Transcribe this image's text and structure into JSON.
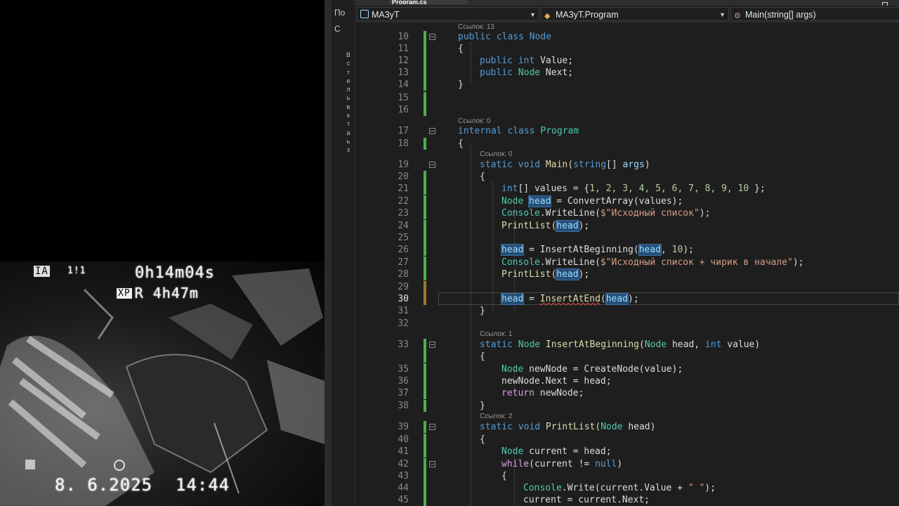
{
  "camera": {
    "badge_ia": "IA",
    "mode": "1!1",
    "timer": "0h14m04s",
    "rec_badge": "XP",
    "remaining": "R  4h47m",
    "date": "8. 6.2025",
    "time": "14:44"
  },
  "ide": {
    "tool_tab_1": "По",
    "tool_tab_2": "С",
    "vertical_letters": [
      "В",
      "с",
      "т",
      "е",
      "л",
      "ь",
      "в",
      "к",
      "т",
      "а",
      "ь",
      "з"
    ],
    "document_tab": "Program.cs",
    "nav": {
      "project": "MA3yT",
      "class": "MA3yT.Program",
      "member": "Main(string[] args)"
    },
    "refs": {
      "node_class": "Ссылок: 13",
      "program_class": "Ссылок: 0",
      "main": "Ссылок: 0",
      "insert_beginning": "Ссылок: 1",
      "print_list": "Ссылок: 2"
    },
    "line_numbers": [
      "10",
      "11",
      "12",
      "13",
      "14",
      "15",
      "16",
      "17",
      "18",
      "19",
      "20",
      "21",
      "22",
      "23",
      "24",
      "25",
      "26",
      "27",
      "28",
      "29",
      "30",
      "31",
      "32",
      "33",
      "35",
      "36",
      "37",
      "38",
      "39",
      "40",
      "41",
      "42",
      "43",
      "44",
      "45"
    ],
    "active_line": "30",
    "code": {
      "l10": "public class Node",
      "l11": "{",
      "l12a": "public int",
      "l12b": " Value;",
      "l13a": "public",
      "l13b": " Node",
      "l13c": " Next;",
      "l14": "}",
      "l17a": "internal class",
      "l17b": " Program",
      "l18": "{",
      "l19a": "static void",
      "l19b": " Main(",
      "l19c": "string",
      "l19d": "[] ",
      "l19e": "args",
      "l19f": ")",
      "l20": "{",
      "l21a": "int",
      "l21b": "[] values = {",
      "l21c": "1, 2, 3, 4, 5, 6, 7, 8, 9, 10",
      "l21d": " };",
      "l22a": "Node",
      "l22b": "head",
      "l22c": " = ConvertArray(values);",
      "l23a": "Console",
      "l23b": ".WriteLine(",
      "l23c": "$\"Исходный список\"",
      "l23d": ");",
      "l24a": "PrintList(",
      "l24b": "head",
      "l24c": ");",
      "l26a": "head",
      "l26b": " = InsertAtBeginning(",
      "l26c": "head",
      "l26d": ", ",
      "l26e": "10",
      "l26f": ");",
      "l27a": "Console",
      "l27b": ".WriteLine(",
      "l27c": "$\"Исходный список + чирик в начале\"",
      "l27d": ");",
      "l28a": "PrintList(",
      "l28b": "head",
      "l28c": ");",
      "l30a": "head",
      "l30b": " = ",
      "l30c": "InsertAtEnd",
      "l30d": "(",
      "l30e": "head",
      "l30f": ");",
      "l31": "}",
      "l33a": "static",
      "l33b": " Node",
      "l33c": " InsertAtBeginning(",
      "l33d": "Node",
      "l33e": " head, ",
      "l33f": "int",
      "l33g": " value)",
      "l35a": "Node",
      "l35b": " newNode = CreateNode(value);",
      "l36": "newNode.Next = head;",
      "l37a": "return",
      "l37b": " newNode;",
      "l38": "}",
      "l39a": "static void",
      "l39b": " PrintList(",
      "l39c": "Node",
      "l39d": " head)",
      "l40": "{",
      "l41a": "Node",
      "l41b": " current = head;",
      "l42a": "while",
      "l42b": "(current != ",
      "l42c": "null",
      "l42d": ")",
      "l43": "{",
      "l44a": "Console",
      "l44b": ".Write(current.Value + ",
      "l44c": "\" \"",
      "l44d": ");",
      "l45": "current = current.Next;",
      "l34": "{"
    }
  }
}
